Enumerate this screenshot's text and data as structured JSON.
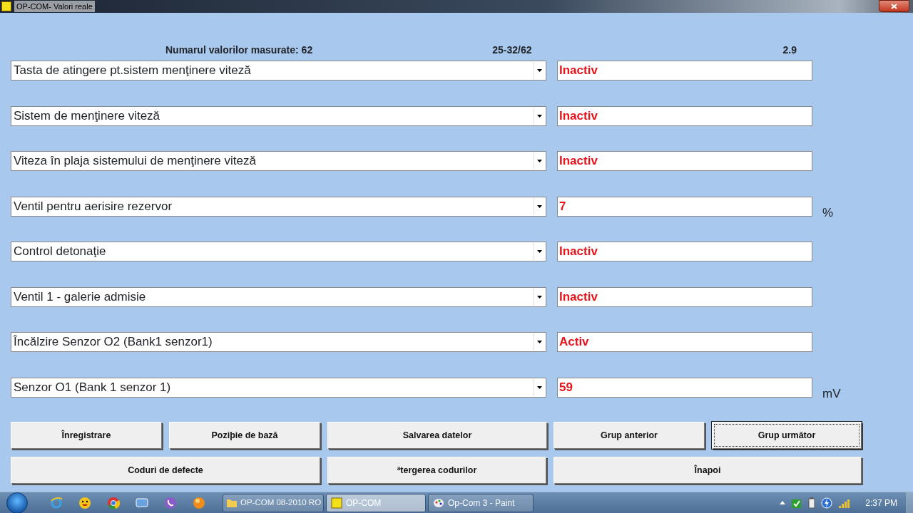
{
  "window": {
    "title": "OP-COM- Valori reale"
  },
  "header": {
    "count_label": "Numarul valorilor masurate: 62",
    "range": "25-32/62",
    "version": "2.9"
  },
  "rows": [
    {
      "name": "Tasta de atingere pt.sistem menţinere viteză",
      "value": "Inactiv"
    },
    {
      "name": "Sistem de menţinere viteză",
      "value": "Inactiv"
    },
    {
      "name": "Viteza în plaja sistemului de menţinere viteză",
      "value": "Inactiv"
    },
    {
      "name": "Ventil pentru aerisire rezervor",
      "value": "7",
      "unit": "%"
    },
    {
      "name": "Control detonaţie",
      "value": "Inactiv"
    },
    {
      "name": "Ventil 1 - galerie admisie",
      "value": "Inactiv"
    },
    {
      "name": "Încălzire Senzor O2 (Bank1 senzor1)",
      "value": "Activ"
    },
    {
      "name": "Senzor O1 (Bank 1 senzor 1)",
      "value": "59",
      "unit": "mV"
    }
  ],
  "buttons": [
    [
      {
        "label": "Înregistrare",
        "focused": false
      },
      {
        "label": "Poziþie de bază",
        "focused": false
      },
      {
        "label": "Salvarea datelor",
        "focused": false
      },
      {
        "label": "Grup anterior",
        "focused": false
      },
      {
        "label": "Grup următor",
        "focused": true
      }
    ],
    [
      {
        "label": "Coduri de defecte",
        "focused": false
      },
      {
        "label": "ªtergerea codurilor",
        "focused": false
      },
      {
        "label": "Înapoi",
        "focused": false
      }
    ]
  ],
  "taskbar": {
    "quick_launch": [
      {
        "kind": "ie"
      },
      {
        "kind": "messenger"
      },
      {
        "kind": "chrome"
      },
      {
        "kind": "chat"
      },
      {
        "kind": "viber"
      },
      {
        "kind": "orange"
      }
    ],
    "tasks": [
      {
        "label": "OP-COM 08-2010 RO",
        "kind": "folder",
        "selected": false
      },
      {
        "label": "OP-COM",
        "kind": "opcom",
        "selected": true
      },
      {
        "label": "Op-Com 3 - Paint",
        "kind": "paint",
        "selected": false
      }
    ],
    "clock": "2:37 PM"
  }
}
